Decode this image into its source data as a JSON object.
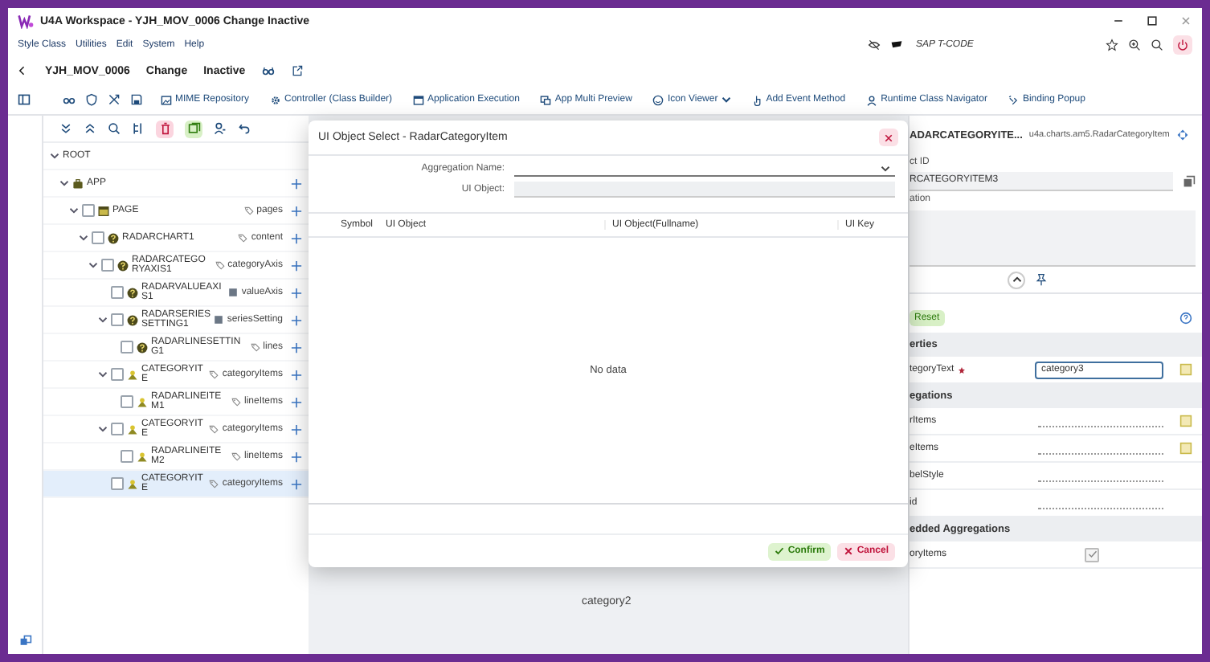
{
  "window": {
    "title": "U4A Workspace - YJH_MOV_0006 Change Inactive"
  },
  "menu": [
    "Style Class",
    "Utilities",
    "Edit",
    "System",
    "Help"
  ],
  "tcode": {
    "placeholder": "SAP T-CODE"
  },
  "header": {
    "name": "YJH_MOV_0006",
    "mode": "Change",
    "status": "Inactive"
  },
  "toolbar": [
    {
      "label": "MIME Repository",
      "dropdown": false
    },
    {
      "label": "Controller (Class Builder)",
      "dropdown": false
    },
    {
      "label": "Application Execution",
      "dropdown": false
    },
    {
      "label": "App Multi Preview",
      "dropdown": false
    },
    {
      "label": "Icon Viewer",
      "dropdown": true
    },
    {
      "label": "Add Event Method",
      "dropdown": false
    },
    {
      "label": "Runtime Class Navigator",
      "dropdown": false
    },
    {
      "label": "Binding Popup",
      "dropdown": false
    }
  ],
  "tree": {
    "label": "ROOT",
    "expanded": true,
    "selected": false,
    "addable": false,
    "children": [
      {
        "label": "APP",
        "kind": "app",
        "expanded": true,
        "selected": false,
        "addable": true,
        "children": [
          {
            "label": "PAGE",
            "kind": "page",
            "aggregation": {
              "name": "pages",
              "kind": "multi"
            },
            "checked": false,
            "expanded": true,
            "selected": false,
            "addable": true,
            "children": [
              {
                "label": "RADARCHART1",
                "kind": "help",
                "aggregation": {
                  "name": "content",
                  "kind": "multi"
                },
                "checked": false,
                "expanded": true,
                "selected": false,
                "addable": true,
                "children": [
                  {
                    "label": "RADARCATEGORYAXIS1",
                    "kind": "help",
                    "aggregation": {
                      "name": "categoryAxis",
                      "kind": "multi"
                    },
                    "checked": false,
                    "expanded": true,
                    "selected": false,
                    "addable": true,
                    "children": [
                      {
                        "label": "RADARVALUEAXIS1",
                        "kind": "help",
                        "aggregation": {
                          "name": "valueAxis",
                          "kind": "single"
                        },
                        "checked": false,
                        "selected": false,
                        "addable": true
                      },
                      {
                        "label": "RADARSERIESSETTING1",
                        "kind": "help",
                        "aggregation": {
                          "name": "seriesSetting",
                          "kind": "single"
                        },
                        "checked": false,
                        "expanded": true,
                        "selected": false,
                        "addable": true,
                        "children": [
                          {
                            "label": "RADARLINESETTING1",
                            "kind": "help",
                            "aggregation": {
                              "name": "lines",
                              "kind": "multi"
                            },
                            "checked": false,
                            "selected": false,
                            "addable": true
                          }
                        ]
                      },
                      {
                        "label": "CATEGORYITE",
                        "kind": "item",
                        "aggregation": {
                          "name": "categoryItems",
                          "kind": "multi"
                        },
                        "checked": false,
                        "expanded": true,
                        "selected": false,
                        "addable": true,
                        "children": [
                          {
                            "label": "RADARLINEITEM1",
                            "kind": "item",
                            "aggregation": {
                              "name": "lineItems",
                              "kind": "multi"
                            },
                            "checked": false,
                            "selected": false,
                            "addable": true
                          }
                        ]
                      },
                      {
                        "label": "CATEGORYITE",
                        "kind": "item",
                        "aggregation": {
                          "name": "categoryItems",
                          "kind": "multi"
                        },
                        "checked": false,
                        "expanded": true,
                        "selected": false,
                        "addable": true,
                        "children": [
                          {
                            "label": "RADARLINEITEM2",
                            "kind": "item",
                            "aggregation": {
                              "name": "lineItems",
                              "kind": "multi"
                            },
                            "checked": false,
                            "selected": false,
                            "addable": true
                          }
                        ]
                      },
                      {
                        "label": "CATEGORYITE",
                        "kind": "item",
                        "aggregation": {
                          "name": "categoryItems",
                          "kind": "multi"
                        },
                        "checked": false,
                        "selected": true,
                        "addable": true
                      }
                    ]
                  }
                ]
              }
            ]
          }
        ]
      }
    ]
  },
  "canvas": {
    "label": "category2"
  },
  "dialog": {
    "title": "UI Object Select - RadarCategoryItem",
    "fields": [
      {
        "label": "Aggregation Name:",
        "kind": "select",
        "disabled": false
      },
      {
        "label": "UI Object:",
        "kind": "input",
        "disabled": true
      }
    ],
    "columns": [
      "Symbol",
      "UI Object",
      "UI Object(Fullname)",
      "UI Key"
    ],
    "empty_text": "No data",
    "buttons": [
      {
        "label": "Confirm",
        "kind": "confirm"
      },
      {
        "label": "Cancel",
        "kind": "cancel"
      }
    ]
  },
  "inspector": {
    "title": "ADARCATEGORYITE...",
    "class_name": "u4a.charts.am5.RadarCategoryItem",
    "id_label": "ct ID",
    "id_value": "RCATEGORYITEM3",
    "desc_label": "ation",
    "reset": "Reset",
    "sections": [
      {
        "title": "erties",
        "rows": [
          {
            "label": "tegoryText",
            "required": true,
            "kind": "input",
            "value": "category3"
          }
        ]
      },
      {
        "title": "egations",
        "rows": [
          {
            "label": "rItems",
            "required": false,
            "kind": "binding"
          },
          {
            "label": "eItems",
            "required": false,
            "kind": "binding"
          },
          {
            "label": "belStyle",
            "required": false,
            "kind": "blank"
          },
          {
            "label": "id",
            "required": false,
            "kind": "blank"
          }
        ]
      },
      {
        "title": "edded Aggregations",
        "rows": [
          {
            "label": "oryItems",
            "required": false,
            "kind": "check",
            "checked": true
          }
        ]
      }
    ]
  }
}
